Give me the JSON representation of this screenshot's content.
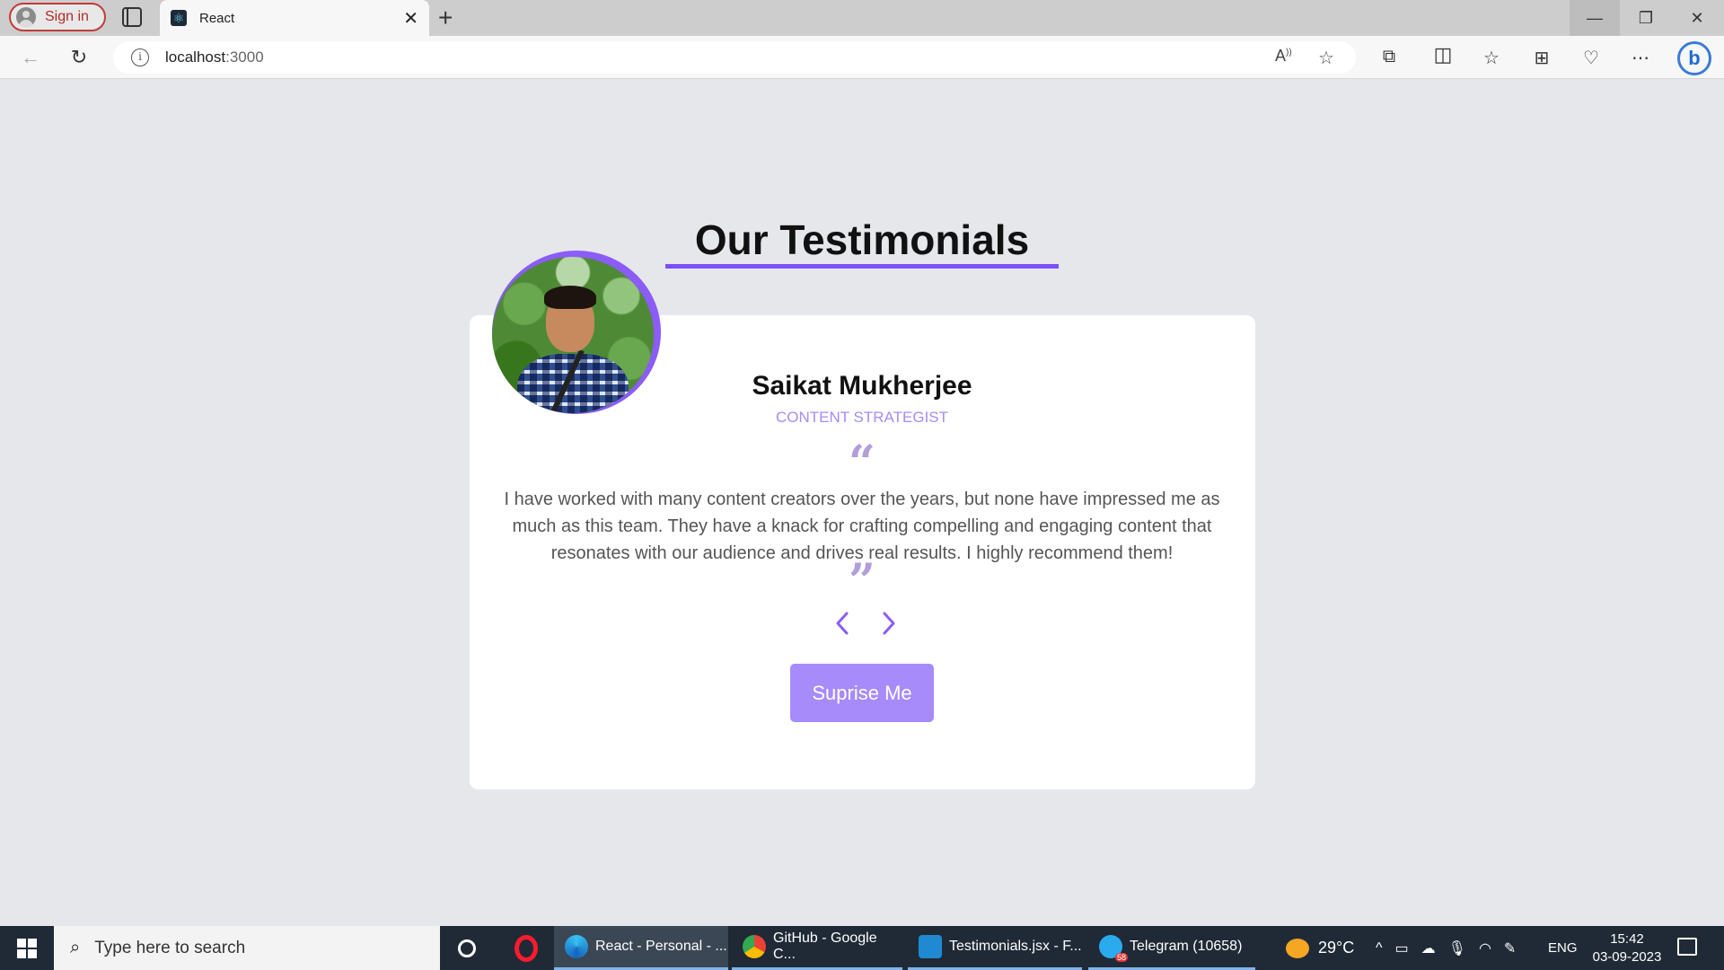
{
  "browser": {
    "signin_label": "Sign in",
    "tab_title": "React",
    "url_host": "localhost",
    "url_port": ":3000"
  },
  "page": {
    "heading": "Our Testimonials",
    "name": "Saikat Mukherjee",
    "role": "CONTENT STRATEGIST",
    "quote_open": "“",
    "quote_close": "”",
    "testimonial": "I have worked with many content creators over the years, but none have impressed me as much as this team. They have a knack for crafting compelling and engaging content that resonates with our audience and drives real results. I highly recommend them!",
    "button_label": "Suprise Me",
    "accent_color": "#8b5cf6",
    "button_color": "#a78bfa"
  },
  "taskbar": {
    "search_placeholder": "Type here to search",
    "apps": [
      {
        "label": "React - Personal - ...",
        "icon": "edge-icon",
        "active": true
      },
      {
        "label": "GitHub - Google C...",
        "icon": "chrome-icon",
        "active": false
      },
      {
        "label": "Testimonials.jsx - F...",
        "icon": "vscode-icon",
        "active": false
      },
      {
        "label": "Telegram (10658)",
        "icon": "telegram-icon",
        "active": false
      }
    ],
    "telegram_badge": "58",
    "weather": "29°C",
    "language": "ENG",
    "time": "15:42",
    "date": "03-09-2023"
  }
}
